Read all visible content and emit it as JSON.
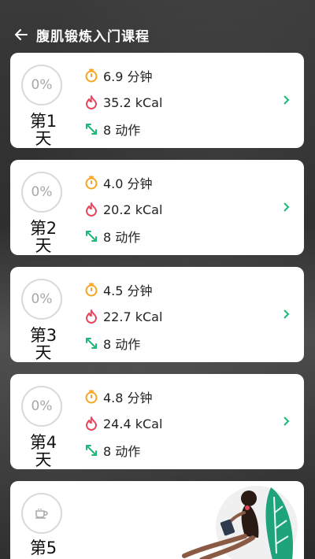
{
  "header": {
    "title": "腹肌锻炼入门课程"
  },
  "days": [
    {
      "progress": "0%",
      "day_label": "第1天",
      "duration": "6.9 分钟",
      "calories": "35.2 kCal",
      "moves": "8 动作"
    },
    {
      "progress": "0%",
      "day_label": "第2天",
      "duration": "4.0 分钟",
      "calories": "20.2 kCal",
      "moves": "8 动作"
    },
    {
      "progress": "0%",
      "day_label": "第3天",
      "duration": "4.5 分钟",
      "calories": "22.7 kCal",
      "moves": "8 动作"
    },
    {
      "progress": "0%",
      "day_label": "第4天",
      "duration": "4.8 分钟",
      "calories": "24.4 kCal",
      "moves": "8 动作"
    }
  ],
  "rest_day": {
    "day_label": "第5",
    "icon": "coffee-cup-icon"
  },
  "colors": {
    "timer": "#f5a623",
    "flame": "#e8475f",
    "moves": "#1fb878",
    "chevron": "#1fb878"
  }
}
